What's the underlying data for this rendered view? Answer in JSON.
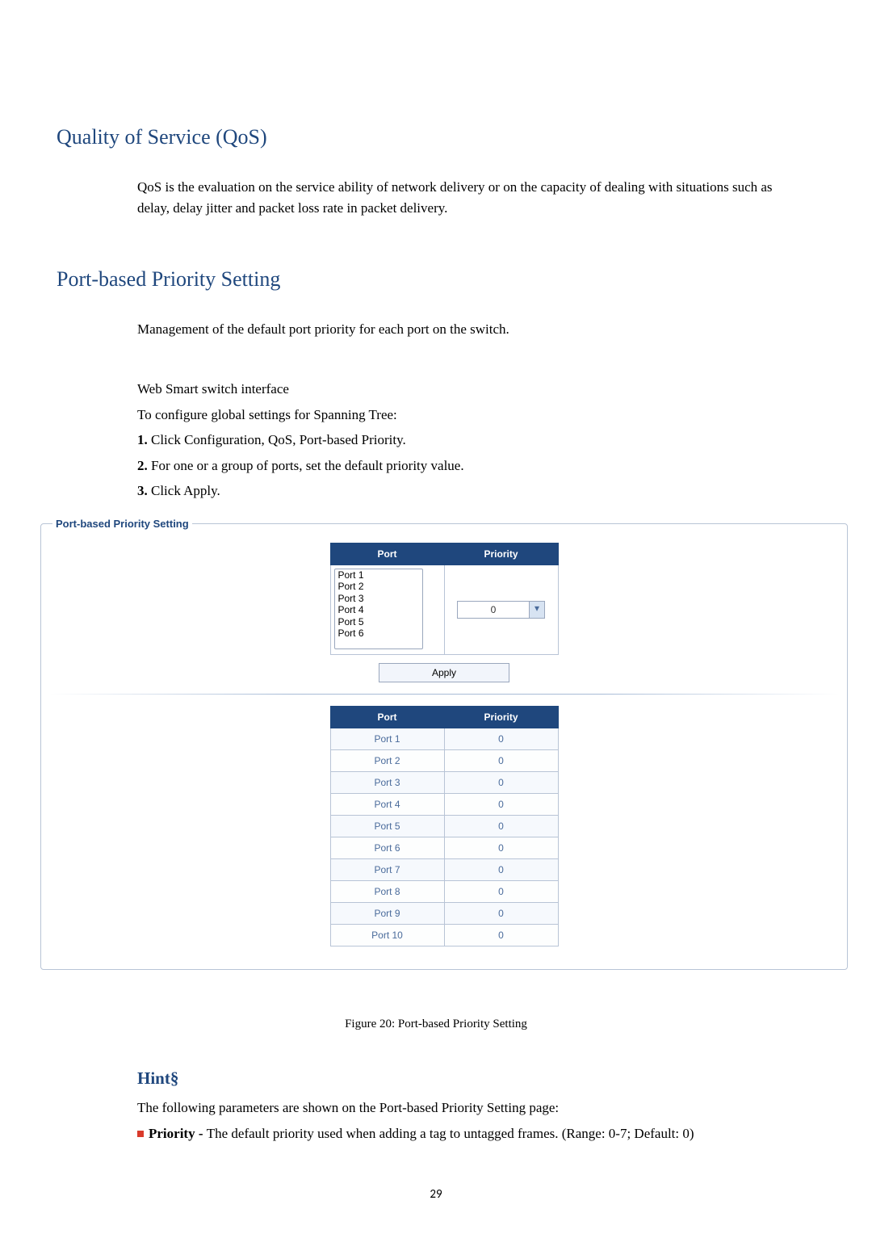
{
  "qos": {
    "heading": "Quality of Service (QoS)",
    "paragraph": "QoS is the evaluation on the service ability of network delivery or on the capacity of dealing with situations such as delay, delay jitter and packet loss rate in packet delivery."
  },
  "port_priority": {
    "heading": "Port-based Priority Setting",
    "intro": "Management of the default port priority for each port on the switch.",
    "sub_caption": "Web Smart switch interface",
    "config_line": "To configure global settings for Spanning Tree:",
    "steps": {
      "s1_num": "1.",
      "s1_text": " Click Configuration, QoS, Port-based Priority.",
      "s2_num": "2.",
      "s2_text": " For one or a group of ports, set the default priority value.",
      "s3_num": "3.",
      "s3_text": " Click Apply."
    }
  },
  "screenshot": {
    "legend": "Port-based Priority Setting",
    "col_port": "Port",
    "col_priority": "Priority",
    "port_list": [
      "Port 1",
      "Port 2",
      "Port 3",
      "Port 4",
      "Port 5",
      "Port 6"
    ],
    "selected_priority": "0",
    "apply_label": "Apply",
    "status_rows": [
      {
        "port": "Port 1",
        "priority": "0"
      },
      {
        "port": "Port 2",
        "priority": "0"
      },
      {
        "port": "Port 3",
        "priority": "0"
      },
      {
        "port": "Port 4",
        "priority": "0"
      },
      {
        "port": "Port 5",
        "priority": "0"
      },
      {
        "port": "Port 6",
        "priority": "0"
      },
      {
        "port": "Port 7",
        "priority": "0"
      },
      {
        "port": "Port 8",
        "priority": "0"
      },
      {
        "port": "Port 9",
        "priority": "0"
      },
      {
        "port": "Port 10",
        "priority": "0"
      }
    ]
  },
  "caption": "Figure 20: Port-based Priority Setting",
  "hint": {
    "heading": "Hint§",
    "line1": "The following parameters are shown on the Port-based Priority Setting page:",
    "bullet_label": "Priority - ",
    "bullet_rest": "The default priority used when adding a tag to untagged frames. (Range: 0-7; Default: 0)"
  },
  "page_number": "29"
}
